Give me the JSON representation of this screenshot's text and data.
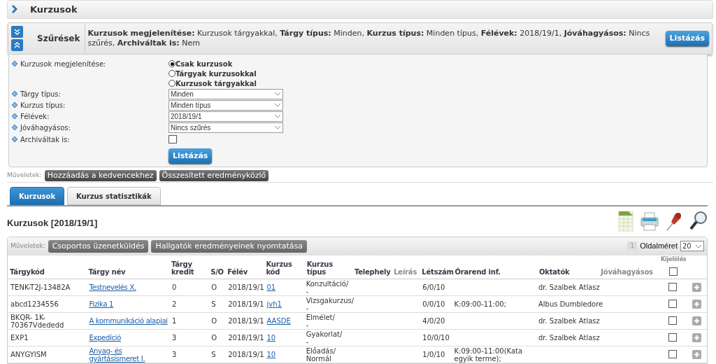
{
  "page_title": "Kurzusok",
  "filter_summary": {
    "label": "Szűrések",
    "text": "**Kurzusok megjelenítése:** Kurzusok tárgyakkal, **Tárgy típus:** Minden, **Kurzus típus:** Minden típus, **Félévek:** 2018/19/1, **Jóváhagyásos:** Nincs szűrés, **Archiváltak is:** Nem",
    "button": "Listázás"
  },
  "filters": {
    "display": {
      "label": "Kurzusok megjelenítése:",
      "options": [
        {
          "label": "Csak kurzusok",
          "selected": true
        },
        {
          "label": "Tárgyak kurzusokkal",
          "selected": false
        },
        {
          "label": "Kurzusok tárgyakkal",
          "selected": false
        }
      ]
    },
    "selects": [
      {
        "label": "Tárgy típus:",
        "value": "Minden"
      },
      {
        "label": "Kurzus típus:",
        "value": "Minden típus"
      },
      {
        "label": "Félévek:",
        "value": "2018/19/1"
      },
      {
        "label": "Jóváhagyásos:",
        "value": "Nincs szűrés"
      }
    ],
    "archived": {
      "label": "Archiváltak is:",
      "checked": false
    },
    "button": "Listázás"
  },
  "actions": {
    "label": "Műveletek:",
    "buttons": [
      "Hozzáadás a kedvencekhez",
      "Összesített eredményközlő"
    ]
  },
  "tabs": [
    {
      "label": "Kurzusok",
      "selected": true
    },
    {
      "label": "Kurzus statisztikák",
      "selected": false
    }
  ],
  "list_title": "Kurzusok [2018/19/1]",
  "table_actions": {
    "label": "Műveletek:",
    "buttons": [
      "Csoportos üzenetküldés",
      "Hallgatók eredményeinek nyomtatása"
    ]
  },
  "pager": {
    "page": "1",
    "size_label": "Oldalméret",
    "size": "20"
  },
  "table": {
    "columns": [
      {
        "label": "Tárgykód",
        "sortable": true
      },
      {
        "label": "Tárgy név",
        "sortable": true
      },
      {
        "label": "Tárgy kredit",
        "sortable": true
      },
      {
        "label": "S/O",
        "sortable": true
      },
      {
        "label": "Félév",
        "sortable": true
      },
      {
        "label": "Kurzus kód",
        "sortable": true
      },
      {
        "label": "Kurzus típus",
        "sortable": true
      },
      {
        "label": "Telephely",
        "sortable": true
      },
      {
        "label": "Leírás",
        "sortable": false
      },
      {
        "label": "Létszám",
        "sortable": true
      },
      {
        "label": "Órarend inf.",
        "sortable": true
      },
      {
        "label": "Oktatók",
        "sortable": true
      },
      {
        "label": "Jóváhagyásos",
        "sortable": false
      },
      {
        "label": "Kijelölés",
        "sortable": false
      }
    ],
    "select_all": false,
    "rows": [
      {
        "code": "TENK-T2J-13482A",
        "name": "Testnevelés X.",
        "credit": "0",
        "so": "O",
        "term": "2018/19/1",
        "course_code": "01",
        "type": [
          "Konzultáció/",
          "-"
        ],
        "headcount": "6/0/10",
        "schedule": "",
        "teachers": "dr. Szalbek Atlasz",
        "checked": false
      },
      {
        "code": "abcd1234556",
        "name": "Fizika 1",
        "credit": "2",
        "so": "S",
        "term": "2018/19/1",
        "course_code": "jvh1",
        "type": [
          "Vizsgakurzus/",
          "-"
        ],
        "headcount": "0/0/10",
        "schedule": "K:09:00-11:00;",
        "teachers": "Albus Dumbledore",
        "checked": false
      },
      {
        "code": "BKQR- 1K-70367Vdededd",
        "name": "A kommunikáció alapjai",
        "credit": "1",
        "so": "O",
        "term": "2018/19/1",
        "course_code": "AASDE",
        "type": [
          "Elmélet/",
          "-"
        ],
        "headcount": "4/0/20",
        "schedule": "",
        "teachers": "dr. Szalbek Atlasz",
        "checked": false
      },
      {
        "code": "EXP1",
        "name": "Expedíció",
        "credit": "3",
        "so": "O",
        "term": "2018/19/1",
        "course_code": "10",
        "type": [
          "Gyakorlat/",
          "-"
        ],
        "headcount": "10/0/10",
        "schedule": "",
        "teachers": "dr. Szalbek Atlasz",
        "checked": false
      },
      {
        "code": "ANYGYISM",
        "name": "Anyag- és gyártásismeret I.",
        "credit": "3",
        "so": "S",
        "term": "2018/19/1",
        "course_code": "10",
        "type": [
          "Előadás/",
          "Normál"
        ],
        "headcount": "1/0/10",
        "schedule": "K:09:00-11:00(Kata egyik terme);",
        "teachers": "",
        "checked": false
      }
    ]
  }
}
